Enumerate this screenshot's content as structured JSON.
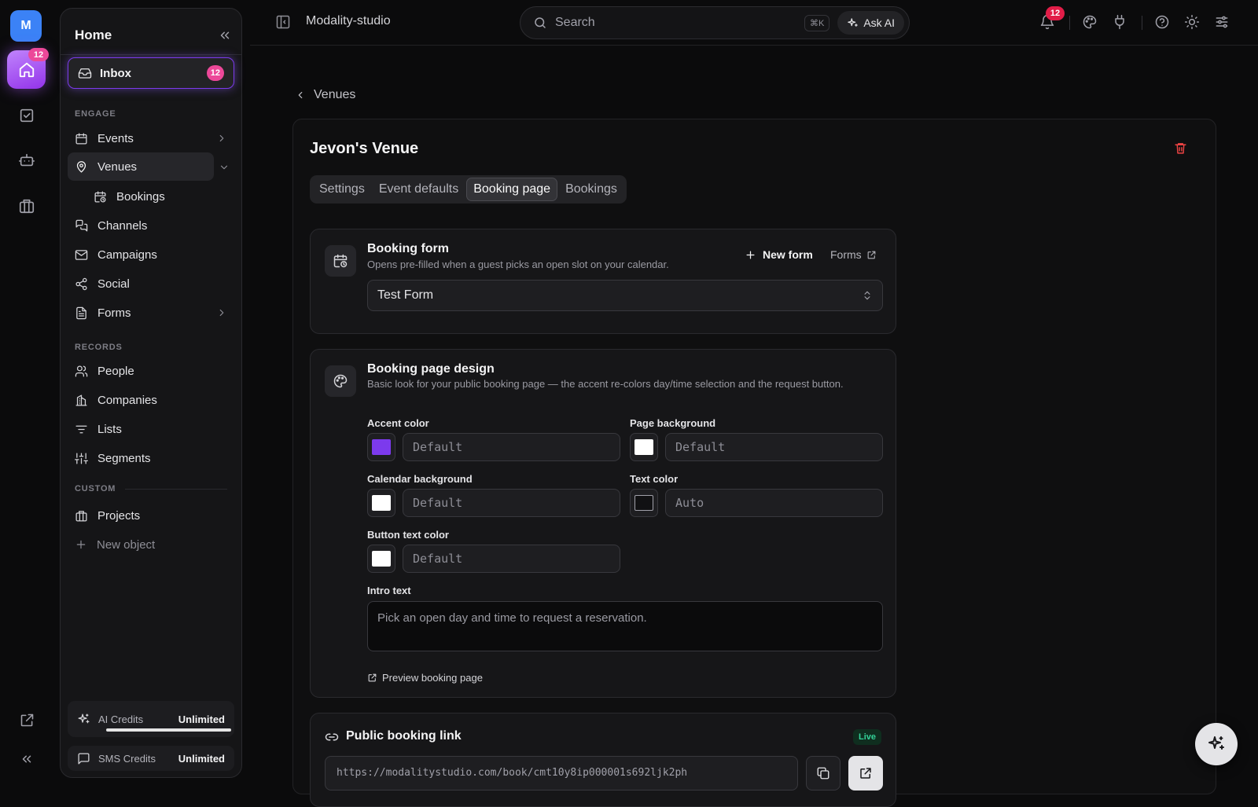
{
  "rail": {
    "avatar": "M",
    "home_badge": "12"
  },
  "sidebar": {
    "title": "Home",
    "inbox": {
      "label": "Inbox",
      "badge": "12"
    },
    "sections": {
      "engage": "ENGAGE",
      "records": "RECORDS",
      "custom": "CUSTOM"
    },
    "engage_items": [
      {
        "label": "Events"
      },
      {
        "label": "Venues"
      },
      {
        "label": "Bookings"
      },
      {
        "label": "Channels"
      },
      {
        "label": "Campaigns"
      },
      {
        "label": "Social"
      },
      {
        "label": "Forms"
      }
    ],
    "records_items": [
      {
        "label": "People"
      },
      {
        "label": "Companies"
      },
      {
        "label": "Lists"
      },
      {
        "label": "Segments"
      }
    ],
    "custom_items": [
      {
        "label": "Projects"
      },
      {
        "label": "New object"
      }
    ],
    "credits": [
      {
        "label": "AI Credits",
        "value": "Unlimited",
        "fill": 1.0
      },
      {
        "label": "SMS Credits",
        "value": "Unlimited"
      }
    ]
  },
  "topbar": {
    "app_name": "Modality-studio",
    "search_placeholder": "Search",
    "shortcut": "⌘K",
    "ask_ai": "Ask AI",
    "notification_badge": "12"
  },
  "main": {
    "breadcrumb": "Venues",
    "venue_title": "Jevon's Venue",
    "tabs": [
      {
        "label": "Settings"
      },
      {
        "label": "Event defaults"
      },
      {
        "label": "Booking page",
        "active": true
      },
      {
        "label": "Bookings"
      }
    ],
    "booking_form": {
      "title": "Booking form",
      "subtitle": "Opens pre-filled when a guest picks an open slot on your calendar.",
      "new_form": "New form",
      "forms_link": "Forms",
      "selected_form": "Test Form"
    },
    "design": {
      "title": "Booking page design",
      "subtitle": "Basic look for your public booking page — the accent re-colors day/time selection and the request button.",
      "fields": {
        "accent": {
          "label": "Accent color",
          "value": "Default",
          "swatch": "#7c3aed"
        },
        "page_bg": {
          "label": "Page background",
          "value": "Default",
          "swatch": "#ffffff"
        },
        "calendar_bg": {
          "label": "Calendar background",
          "value": "Default",
          "swatch": "#ffffff"
        },
        "text_color": {
          "label": "Text color",
          "value": "Auto",
          "swatch": "#111113"
        },
        "button_text": {
          "label": "Button text color",
          "value": "Default",
          "swatch": "#ffffff"
        }
      },
      "intro_label": "Intro text",
      "intro_placeholder": "Pick an open day and time to request a reservation.",
      "preview_link": "Preview booking page"
    },
    "public_link": {
      "title": "Public booking link",
      "status": "Live",
      "url": "https://modalitystudio.com/book/cmt10y8ip000001s692ljk2ph"
    }
  }
}
